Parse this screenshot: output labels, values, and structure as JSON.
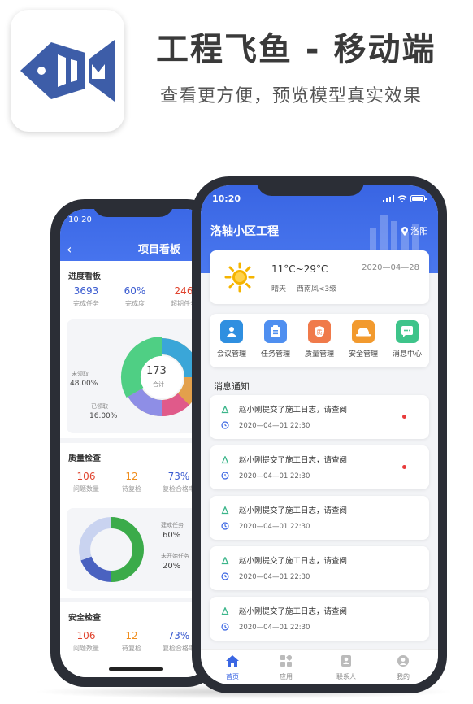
{
  "header": {
    "title": "工程飞鱼 - 移动端",
    "subtitle": "查看更方便，预览模型真实效果"
  },
  "back_phone": {
    "time": "10:20",
    "title": "项目看板",
    "progress": {
      "title": "进度看板",
      "stats": [
        {
          "value": "3693",
          "label": "完成任务"
        },
        {
          "value": "60%",
          "label": "完成度"
        },
        {
          "value": "246",
          "label": "超期任务"
        }
      ],
      "donut_center_value": "173",
      "donut_center_label": "合计",
      "legend": [
        {
          "label": "未领取",
          "value": "48.00%"
        },
        {
          "label": "已领取",
          "value": "16.00%"
        }
      ]
    },
    "quality": {
      "title": "质量检查",
      "stats": [
        {
          "value": "106",
          "label": "问题数量"
        },
        {
          "value": "12",
          "label": "待复检"
        },
        {
          "value": "73%",
          "label": "复检合格率"
        }
      ],
      "legend": [
        {
          "label": "建成任务",
          "value": "60%"
        },
        {
          "label": "未开始任务",
          "value": "20%"
        }
      ]
    },
    "safety": {
      "title": "安全检查",
      "stats": [
        {
          "value": "106",
          "label": "问题数量"
        },
        {
          "value": "12",
          "label": "待复检"
        },
        {
          "value": "73%",
          "label": "复检合格率"
        }
      ]
    }
  },
  "front_phone": {
    "time": "10:20",
    "project_name": "洛轴小区工程",
    "location": "洛阳",
    "weather": {
      "temperature": "11°C~29°C",
      "date": "2020—04—28",
      "condition": "晴天",
      "wind": "西南风<3级",
      "icon": "sun-icon"
    },
    "menu": [
      {
        "label": "会议管理",
        "icon": "meeting-icon",
        "color": "#2f8fe0"
      },
      {
        "label": "任务管理",
        "icon": "task-icon",
        "color": "#4f8ff0"
      },
      {
        "label": "质量管理",
        "icon": "quality-icon",
        "color": "#f07a4a"
      },
      {
        "label": "安全管理",
        "icon": "helmet-icon",
        "color": "#f29a2e"
      },
      {
        "label": "消息中心",
        "icon": "message-icon",
        "color": "#3ec48a"
      }
    ],
    "notice_title": "消息通知",
    "notices": [
      {
        "text": "赵小刚提交了施工日志，请查阅",
        "time": "2020—04—01   22:30",
        "unread": true
      },
      {
        "text": "赵小刚提交了施工日志，请查阅",
        "time": "2020—04—01   22:30",
        "unread": true
      },
      {
        "text": "赵小刚提交了施工日志，请查阅",
        "time": "2020—04—01   22:30",
        "unread": false
      },
      {
        "text": "赵小刚提交了施工日志，请查阅",
        "time": "2020—04—01   22:30",
        "unread": false
      },
      {
        "text": "赵小刚提交了施工日志，请查阅",
        "time": "2020—04—01   22:30",
        "unread": false
      }
    ],
    "tabs": [
      {
        "label": "首页",
        "icon": "home-icon",
        "active": true
      },
      {
        "label": "应用",
        "icon": "apps-icon",
        "active": false
      },
      {
        "label": "联系人",
        "icon": "contacts-icon",
        "active": false
      },
      {
        "label": "我的",
        "icon": "profile-icon",
        "active": false
      }
    ]
  }
}
